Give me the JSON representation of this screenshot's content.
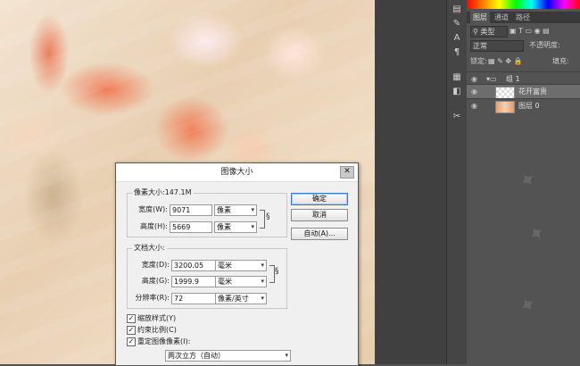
{
  "panel": {
    "tabs": [
      "图层",
      "通道",
      "路径"
    ],
    "filter_label": "类型",
    "blend_mode": "正常",
    "opacity_label": "不透明度:",
    "lock_label": "锁定:",
    "fill_label": "填充:",
    "layers": [
      {
        "name": "组 1",
        "type": "group"
      },
      {
        "name": "花开富贵",
        "type": "layer"
      },
      {
        "name": "图层 0",
        "type": "layer"
      }
    ]
  },
  "dialog": {
    "title": "图像大小",
    "pixel_dimensions": {
      "legend": "像素大小:147.1M",
      "width_label": "宽度(W):",
      "width_value": "9071",
      "width_unit": "像素",
      "height_label": "高度(H):",
      "height_value": "5669",
      "height_unit": "像素"
    },
    "document_size": {
      "legend": "文档大小:",
      "width_label": "宽度(D):",
      "width_value": "3200.05",
      "width_unit": "毫米",
      "height_label": "高度(G):",
      "height_value": "1999.9",
      "height_unit": "毫米",
      "resolution_label": "分辨率(R):",
      "resolution_value": "72",
      "resolution_unit": "像素/英寸"
    },
    "buttons": {
      "ok": "确定",
      "cancel": "取消",
      "auto": "自动(A)..."
    },
    "checkboxes": {
      "scale_styles": "缩放样式(Y)",
      "constrain": "约束比例(C)",
      "resample": "重定图像像素(I):"
    },
    "resample_method": "两次立方（自动）"
  }
}
